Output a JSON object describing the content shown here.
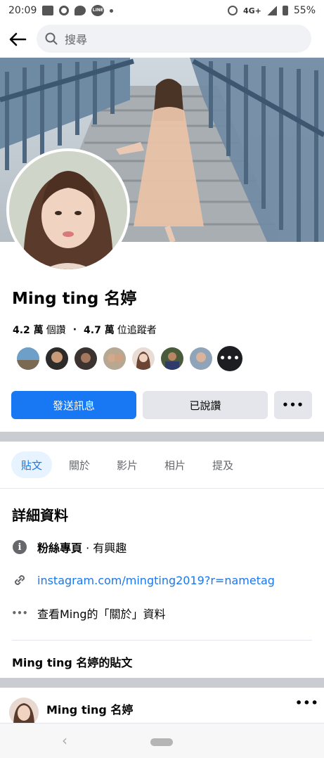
{
  "status_bar": {
    "time": "20:09",
    "line_label": "LINE",
    "network": "4G+",
    "battery": "55%"
  },
  "search": {
    "placeholder": "搜尋"
  },
  "profile": {
    "name": "Ming ting 名婷",
    "likes_count": "4.2 萬",
    "likes_label": "個讚",
    "followers_count": "4.7 萬",
    "followers_label": "位追蹤者",
    "more_friends": "•••"
  },
  "actions": {
    "message": "發送訊息",
    "liked": "已說讚",
    "more": "•••"
  },
  "tabs": [
    {
      "label": "貼文"
    },
    {
      "label": "關於"
    },
    {
      "label": "影片"
    },
    {
      "label": "相片"
    },
    {
      "label": "提及"
    }
  ],
  "details": {
    "title": "詳細資料",
    "category_main": "粉絲專頁",
    "category_sub": " · 有興趣",
    "link": "instagram.com/mingting2019?r=nametag",
    "about": "查看Ming的「關於」資料"
  },
  "posts": {
    "title": "Ming ting 名婷的貼文",
    "author": "Ming ting 名婷",
    "more": "•••"
  },
  "colors": {
    "accent": "#1877f2",
    "secondary_button": "#e4e6eb",
    "divider": "#c9ccd1"
  },
  "icons": [
    "back-arrow-icon",
    "search-icon",
    "info-icon",
    "link-icon",
    "more-dots-icon"
  ]
}
